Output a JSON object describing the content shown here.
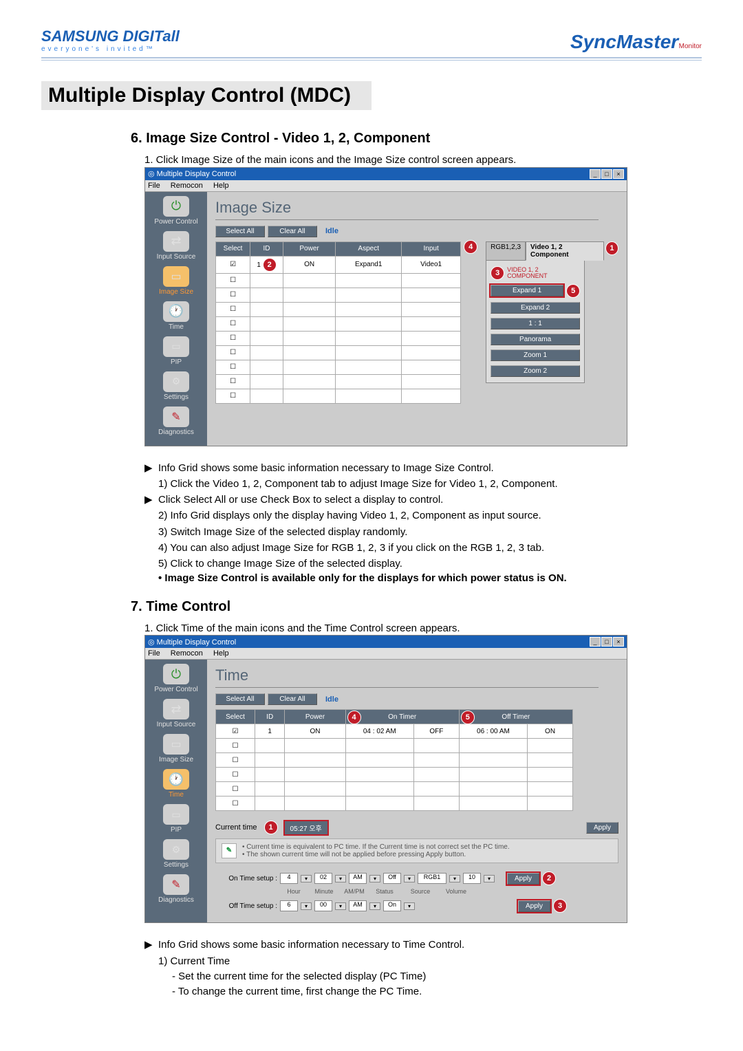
{
  "header": {
    "brand": "SAMSUNG DIGITall",
    "tagline": "everyone's invited™",
    "product": "SyncMaster",
    "product_sub": "Monitor"
  },
  "page_title": "Multiple Display Control (MDC)",
  "section6": {
    "title": "6. Image Size Control - Video 1, 2, Component",
    "intro": "1.  Click Image Size of the main icons and the Image Size control screen appears.",
    "bullet1": "Info Grid shows some basic information necessary to Image Size Control.",
    "n1": "1) Click the Video 1, 2, Component tab to adjust Image Size for Video 1, 2, Component.",
    "n1b": "Click Select All or use Check Box to select a display to control.",
    "n2": "2) Info Grid displays only the display having Video 1, 2, Component as input source.",
    "n3": "3) Switch Image Size of the selected display randomly.",
    "n4": "4) You can also adjust Image Size for RGB 1, 2, 3 if you click on the RGB 1, 2, 3 tab.",
    "n5": "5) Click to change Image Size of the selected display.",
    "note": "• Image Size Control is available only for the displays for which power status is ON."
  },
  "section7": {
    "title": "7. Time Control",
    "intro": "1.  Click Time of the main icons and the Time Control screen appears.",
    "bullet1": "Info Grid shows some basic information necessary to Time Control.",
    "n1": "1) Current Time",
    "n1a": "- Set the current time for the selected display (PC Time)",
    "n1b": "- To change the current time, first change the PC Time."
  },
  "app": {
    "title": "Multiple Display Control",
    "menu": {
      "file": "File",
      "remocon": "Remocon",
      "help": "Help"
    },
    "sidebar": {
      "power": "Power Control",
      "input": "Input Source",
      "imagesize": "Image Size",
      "time": "Time",
      "pip": "PIP",
      "settings": "Settings",
      "diag": "Diagnostics"
    },
    "imagesize_panel": {
      "title": "Image Size",
      "select_all": "Select All",
      "clear_all": "Clear All",
      "idle": "Idle",
      "cols": {
        "select": "Select",
        "id": "ID",
        "power": "Power",
        "aspect": "Aspect",
        "input": "Input"
      },
      "tabs": {
        "rgb": "RGB1,2,3",
        "video": "Video 1, 2\nComponent"
      },
      "panel_label": "VIDEO 1, 2\nCOMPONENT",
      "buttons": {
        "expand1": "Expand 1",
        "expand2": "Expand 2",
        "ratio": "1 : 1",
        "panorama": "Panorama",
        "zoom1": "Zoom 1",
        "zoom2": "Zoom 2"
      },
      "row1": {
        "id": "1",
        "power": "ON",
        "aspect": "Expand1",
        "input": "Video1"
      }
    },
    "time_panel": {
      "title": "Time",
      "select_all": "Select All",
      "clear_all": "Clear All",
      "idle": "Idle",
      "cols": {
        "select": "Select",
        "id": "ID",
        "power": "Power",
        "ontimer": "On Timer",
        "offtimer": "Off Timer"
      },
      "row1": {
        "id": "1",
        "power": "ON",
        "on_t": "04 : 02  AM",
        "on_s": "OFF",
        "off_t": "06 : 00  AM",
        "off_s": "ON"
      },
      "current_time_label": "Current time",
      "current_time_value": "05:27 오후",
      "note_a": "•  Current time is equivalent to PC time. If the Current time is not correct set the PC time.",
      "note_b": "•  The shown current time will not be applied before pressing Apply button.",
      "on_time_setup": "On Time setup :",
      "off_time_setup": "Off Time setup :",
      "sublabels": {
        "hour": "Hour",
        "minute": "Minute",
        "ampm": "AM/PM",
        "status": "Status",
        "source": "Source",
        "volume": "Volume"
      },
      "on_vals": {
        "hour": "4",
        "minute": "02",
        "ampm": "AM",
        "status": "Off",
        "source": "RGB1",
        "volume": "10"
      },
      "off_vals": {
        "hour": "6",
        "minute": "00",
        "ampm": "AM",
        "status": "On"
      },
      "apply": "Apply"
    }
  }
}
